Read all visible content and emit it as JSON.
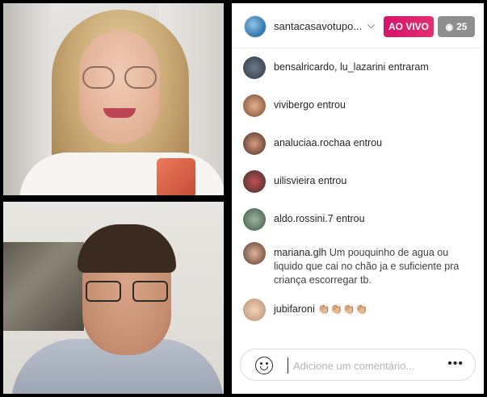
{
  "header": {
    "host_name": "santacasavotupo...",
    "live_label": "AO VIVO",
    "viewer_count": "25"
  },
  "comments": [
    {
      "user": "bensalricardo, lu_lazarini entraram",
      "text": ""
    },
    {
      "user": "vivibergo entrou",
      "text": ""
    },
    {
      "user": "analuciaa.rochaa entrou",
      "text": ""
    },
    {
      "user": "uilisvieira entrou",
      "text": ""
    },
    {
      "user": "aldo.rossini.7 entrou",
      "text": ""
    },
    {
      "user": "mariana.glh",
      "text": "Um pouquinho de agua ou liquido que cai no chão ja e suficiente pra criança escorregar tb."
    },
    {
      "user": "jubifaroni",
      "text": "👏🏼👏🏼👏🏼👏🏼"
    }
  ],
  "footer": {
    "placeholder": "Adicione um comentário..."
  }
}
